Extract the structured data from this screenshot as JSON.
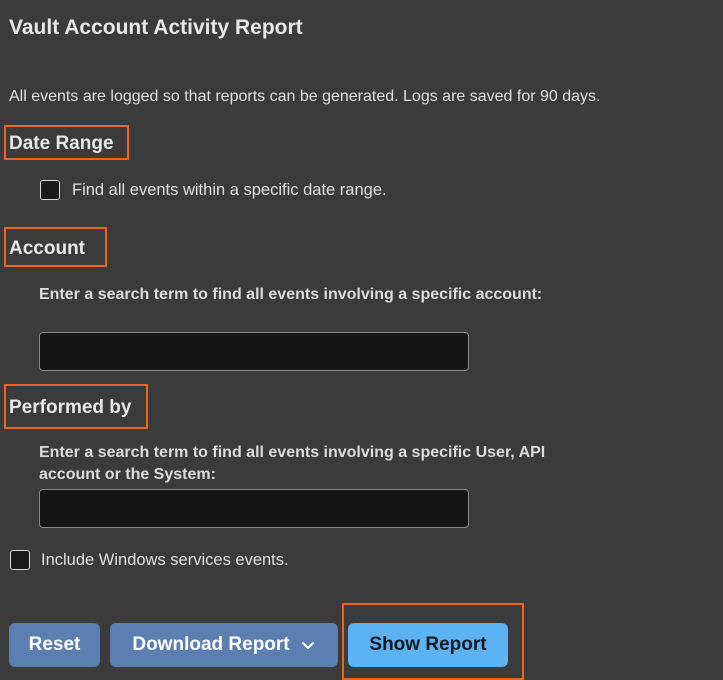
{
  "page": {
    "title": "Vault Account Activity Report",
    "intro": "All events are logged so that reports can be generated. Logs are saved for 90 days."
  },
  "date_range": {
    "heading": "Date Range",
    "checkbox_label": "Find all events within a specific date range.",
    "checked": false
  },
  "account": {
    "heading": "Account",
    "label": "Enter a search term to find all events involving a specific account:",
    "value": "",
    "placeholder": ""
  },
  "performed_by": {
    "heading": "Performed by",
    "label": "Enter a search term to find all events involving a specific User, API account or the System:",
    "value": "",
    "placeholder": ""
  },
  "windows_services": {
    "checkbox_label": "Include Windows services events.",
    "checked": false
  },
  "actions": {
    "reset_label": "Reset",
    "download_label": "Download Report",
    "download_icon": "chevron-down-icon",
    "show_label": "Show Report"
  },
  "colors": {
    "background": "#3b3b3b",
    "highlight": "#f0641e",
    "secondary_button": "#5a7fb0",
    "primary_button": "#5cb2f2"
  }
}
